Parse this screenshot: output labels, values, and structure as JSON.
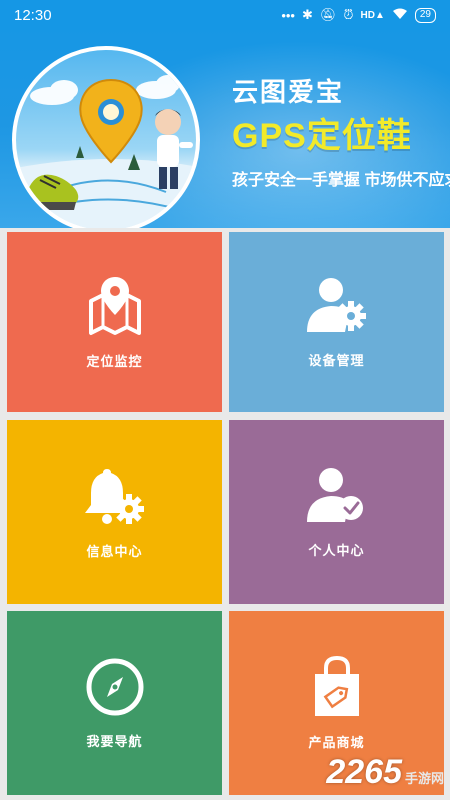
{
  "status_bar": {
    "time": "12:30",
    "battery": "29",
    "icons": [
      "dots-icon",
      "bluetooth-icon",
      "mute-bell-icon",
      "alarm-icon",
      "hd-signal-icon",
      "wifi-icon",
      "battery-icon"
    ]
  },
  "banner": {
    "title": "云图爱宝",
    "headline": "GPS定位鞋",
    "slogan": "孩子安全一手掌握 市场供不应求"
  },
  "tiles": [
    {
      "label": "定位监控",
      "icon": "map-pin-icon",
      "color": "#ef6a4f"
    },
    {
      "label": "设备管理",
      "icon": "user-gear-icon",
      "color": "#6aaed8"
    },
    {
      "label": "信息中心",
      "icon": "bell-gear-icon",
      "color": "#f4b400"
    },
    {
      "label": "个人中心",
      "icon": "user-check-icon",
      "color": "#9a6b97"
    },
    {
      "label": "我要导航",
      "icon": "compass-icon",
      "color": "#3f9a67"
    },
    {
      "label": "产品商城",
      "icon": "shopping-bag-icon",
      "color": "#ef7f42"
    }
  ],
  "watermark": {
    "number": "2265",
    "text": "手游网"
  }
}
